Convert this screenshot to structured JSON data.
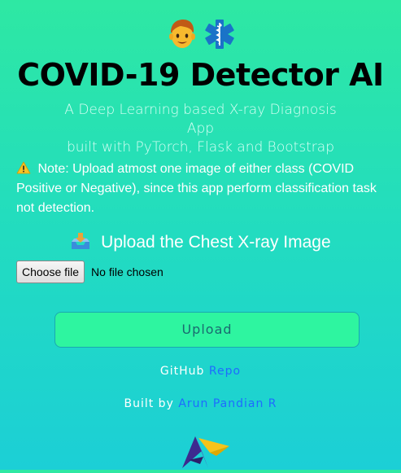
{
  "header": {
    "emoji_left": "boy-face-icon",
    "emoji_right": "medical-caduceus-icon",
    "title": "COVID-19 Detector AI",
    "subtitle_line1": "A Deep Learning based X-ray Diagnosis App",
    "subtitle_line2": "built with PyTorch, Flask and Bootstrap"
  },
  "note": {
    "icon": "warning-icon",
    "text": "Note: Upload atmost one image of either class (COVID Positive or Negative), since this app perform classification task not detection."
  },
  "upload_section": {
    "icon": "inbox-tray-icon",
    "heading": "Upload the Chest X-ray Image",
    "choose_file_label": "Choose file",
    "file_status": "No file chosen",
    "upload_button_label": "Upload"
  },
  "footer": {
    "github_prefix": "GitHub",
    "github_link": "Repo",
    "built_prefix": "Built by",
    "author_link": "Arun Pandian R",
    "logo_icon": "ap-logo-icon"
  },
  "colors": {
    "bg_top": "#2ee8a3",
    "bg_bottom": "#1ccfd6",
    "link": "#1e6bff",
    "upload_button_bg": "#2ef5a0",
    "title": "#000000"
  }
}
